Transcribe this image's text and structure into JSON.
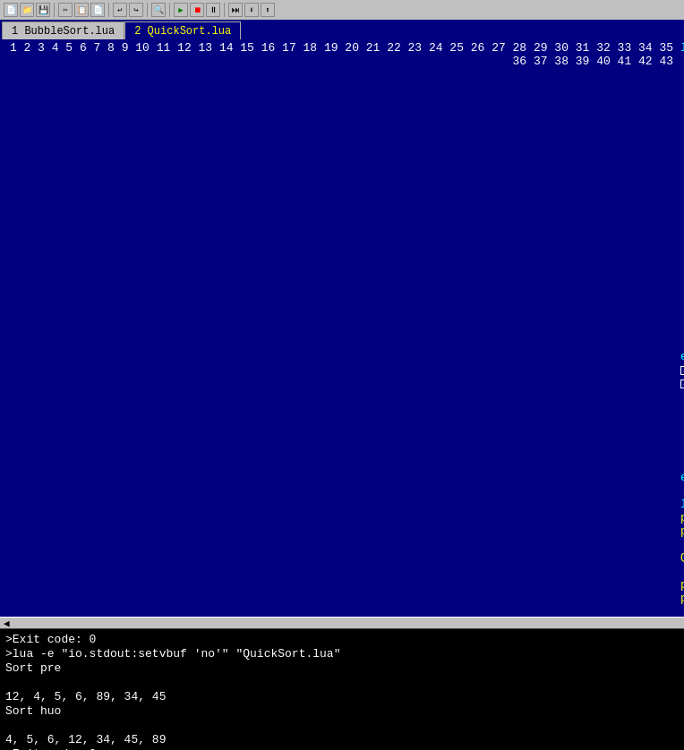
{
  "toolbar": {
    "icons": [
      "📁",
      "💾",
      "🖨",
      "✂",
      "📋",
      "📄",
      "↩",
      "↪",
      "🔍",
      "⚙",
      "▶",
      "⏹",
      "⏸"
    ]
  },
  "tabs": [
    {
      "label": "1 BubbleSort.lua",
      "active": false
    },
    {
      "label": "2 QuickSort.lua",
      "active": true
    }
  ],
  "console": {
    "lines": [
      ">Exit code: 0",
      ">lua -e \"io.stdout:setvbuf 'no'\" \"QuickSort.lua\"",
      "Sort pre",
      "",
      "12, 4, 5, 6, 89, 34, 45",
      "Sort huo",
      "",
      "4, 5, 6, 12, 34, 45, 89",
      ">Exit code: 0"
    ]
  }
}
